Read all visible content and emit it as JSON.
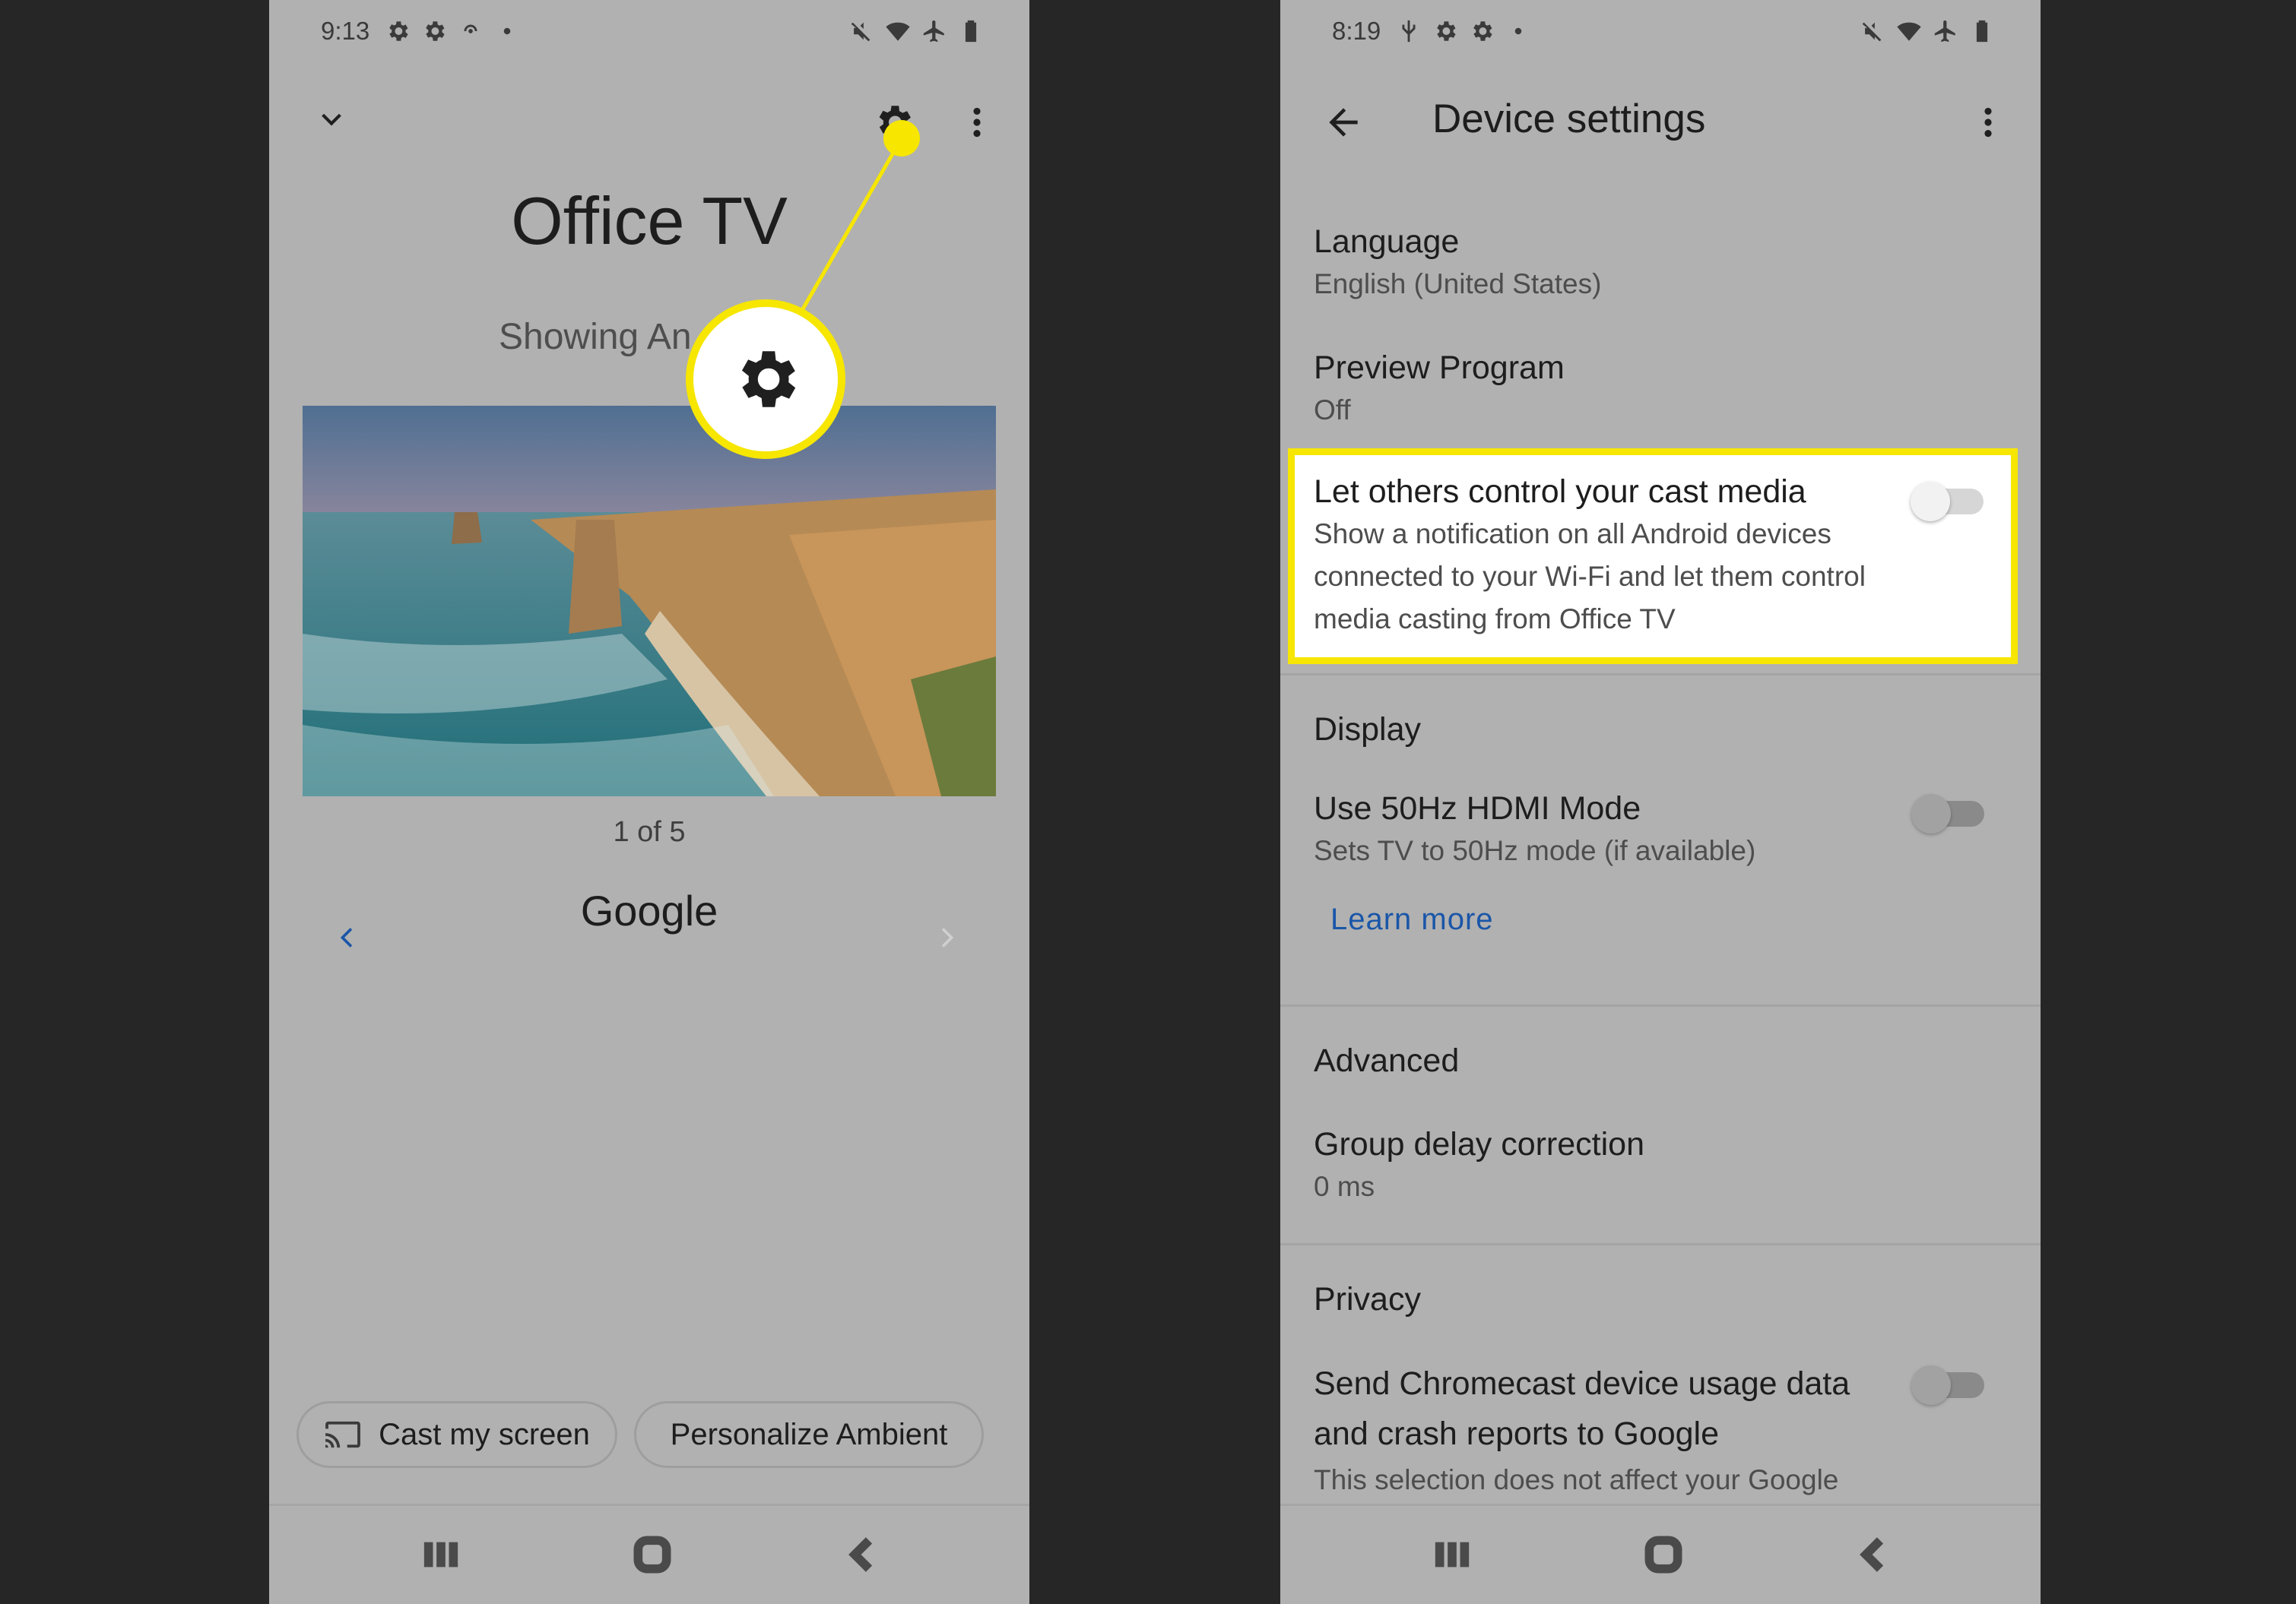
{
  "left": {
    "status_time": "9:13",
    "device_title": "Office TV",
    "showing_text": "Showing An",
    "counter": "1 of 5",
    "source": "Google",
    "cast_button": "Cast my screen",
    "personalize_button": "Personalize Ambient"
  },
  "right": {
    "status_time": "8:19",
    "page_title": "Device settings",
    "language": {
      "title": "Language",
      "value": "English (United States)"
    },
    "preview": {
      "title": "Preview Program",
      "value": "Off"
    },
    "cast_control": {
      "title": "Let others control your cast media",
      "line1": "Show a notification on all Android devices",
      "line2": "connected to your Wi-Fi and let them control",
      "line3": "media casting from Office TV",
      "enabled": false
    },
    "display_head": "Display",
    "hdmi": {
      "title": "Use 50Hz HDMI Mode",
      "value": "Sets TV to 50Hz mode (if available)",
      "enabled": false
    },
    "learn_more": "Learn more",
    "advanced_head": "Advanced",
    "delay": {
      "title": "Group delay correction",
      "value": "0 ms"
    },
    "privacy_head": "Privacy",
    "usage": {
      "line1": "Send Chromecast device usage data",
      "line2": "and crash reports to Google",
      "sub": "This selection does not affect your Google",
      "enabled": false
    }
  },
  "colors": {
    "highlight": "#f6e600",
    "link": "#1a56a8",
    "phone_bg": "#b1b1b1",
    "page_bg": "#262626"
  },
  "icons": [
    "gear-icon",
    "more-vert-icon",
    "chevron-down-icon",
    "back-arrow-icon",
    "cast-icon",
    "recents-icon",
    "home-icon",
    "nav-back-icon"
  ]
}
